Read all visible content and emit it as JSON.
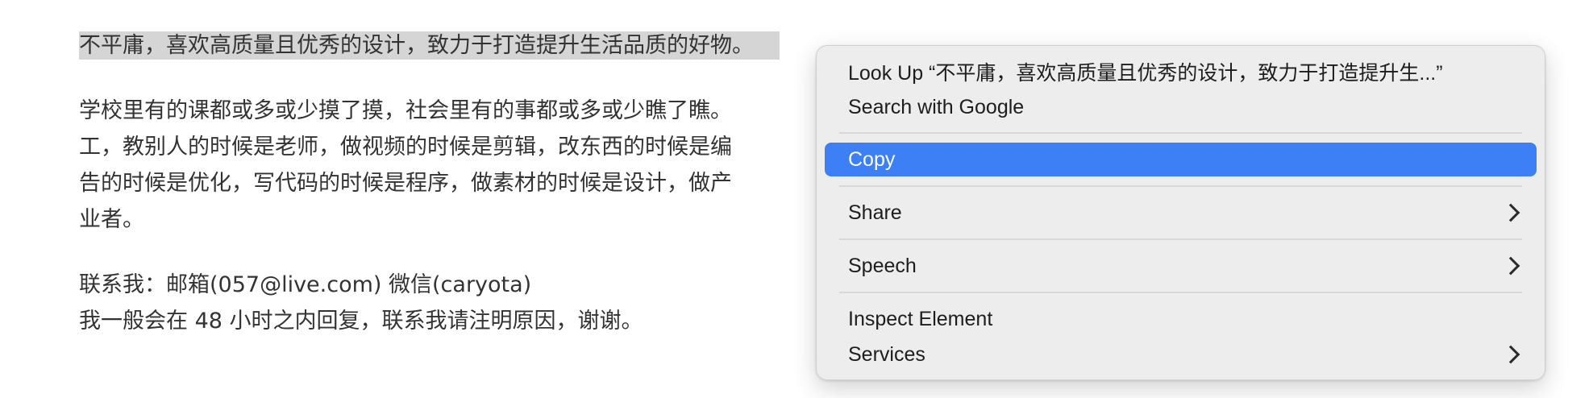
{
  "page": {
    "lines": [
      "不平庸，喜欢高质量且优秀的设计，致力于打造提升生活品质的好物。",
      "学校里有的课都或多或少摸了摸，社会里有的事都或多或少瞧了瞧。",
      "工，教别人的时候是老师，做视频的时候是剪辑，改东西的时候是编",
      "告的时候是优化，写代码的时候是程序，做素材的时候是设计，做产",
      "业者。",
      "联系我：邮箱(057@live.com) 微信(caryota)",
      "我一般会在 48 小时之内回复，联系我请注明原因，谢谢。"
    ]
  },
  "context_menu": {
    "look_up": "Look Up “不平庸，喜欢高质量且优秀的设计，致力于打造提升生...”",
    "search_google": "Search with Google",
    "copy": "Copy",
    "share": "Share",
    "speech": "Speech",
    "inspect_element": "Inspect Element",
    "services": "Services"
  },
  "colors": {
    "selection_highlight": "#d5d5d5",
    "menu_background": "#ececec",
    "menu_selected": "#3d7ff5"
  }
}
